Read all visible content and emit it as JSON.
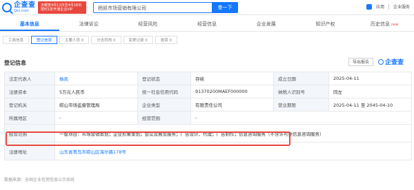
{
  "header": {
    "logo_cn": "企查查",
    "logo_en": "Qcc.com",
    "promo_line1": "天眼查4月12日至4月18日",
    "promo_line2": "限时1折开通企业VIP",
    "search_value": "杨凯市场营销有限公司",
    "search_button": "查一下",
    "app_label": "应用",
    "user_label": "企业服务"
  },
  "tabs": [
    {
      "label": "基本信息"
    },
    {
      "label": "法律诉讼"
    },
    {
      "label": "经营风险"
    },
    {
      "label": "经营信息"
    },
    {
      "label": "企业发展"
    },
    {
      "label": "知识产权"
    },
    {
      "label": "历史信息",
      "badge": "new"
    }
  ],
  "subtabs": [
    "工商信息",
    "登记信息",
    "主要人员 0",
    "分支机构 0",
    "变更记录 0",
    "投资 0"
  ],
  "section": {
    "title": "登记信息",
    "export_label": "导出报告",
    "brand": "企查查"
  },
  "rows": [
    [
      "法定代表人",
      "杨凯",
      "登记状态",
      "存续",
      "成立日期",
      "2025-04-11"
    ],
    [
      "注册资本",
      "5万元人民币",
      "统一社会信用代码",
      "91370200MAEF000000",
      "纳税人识别号",
      "同左"
    ],
    [
      "登记机关",
      "崂山市场监督管理局",
      "企业类型",
      "有限责任公司",
      "营业期限",
      "2025-04-11 至 2045-04-10"
    ],
    [
      "所属地区",
      "-",
      "经营范围",
      "-"
    ]
  ],
  "scope": {
    "label": "经营范围",
    "value": "一般项目：市场营销策划；企业形象策划；会议及展览服务；广告设计、代理；广告制作；信息咨询服务（不含许可类信息咨询服务）"
  },
  "address": {
    "label": "注册地址",
    "value": "山东省青岛市崂山区海尔路178号"
  },
  "footer": "数据来源：全国企业信用信息公示系统"
}
